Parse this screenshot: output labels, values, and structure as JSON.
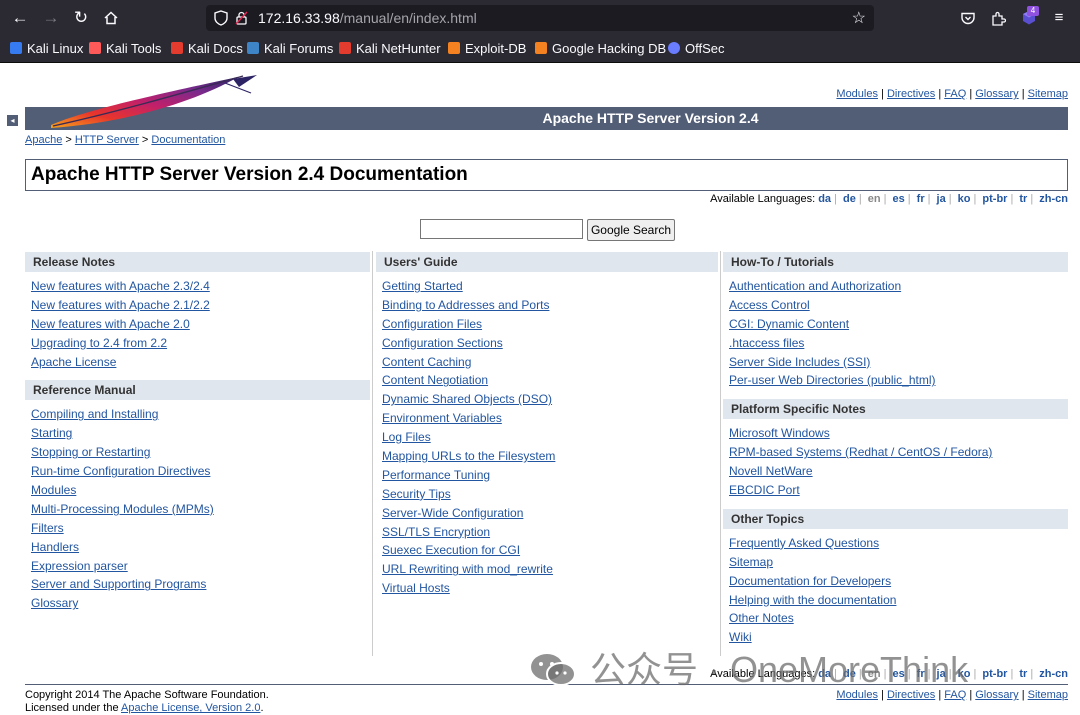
{
  "browser": {
    "url_host": "172.16.33.98",
    "url_path": "/manual/en/index.html",
    "extension_badge": "4",
    "bookmarks": [
      {
        "label": "Kali Linux",
        "color": "#367bf0"
      },
      {
        "label": "Kali Tools",
        "color": "#ff5a5a"
      },
      {
        "label": "Kali Docs",
        "color": "#e33b2e"
      },
      {
        "label": "Kali Forums",
        "color": "#3d85c6"
      },
      {
        "label": "Kali NetHunter",
        "color": "#e33b2e"
      },
      {
        "label": "Exploit-DB",
        "color": "#f58220"
      },
      {
        "label": "Google Hacking DB",
        "color": "#f58220"
      },
      {
        "label": "OffSec",
        "color": "#6a7cff"
      }
    ]
  },
  "header": {
    "top_links": [
      "Modules",
      "Directives",
      "FAQ",
      "Glossary",
      "Sitemap"
    ],
    "banner_title": "Apache HTTP Server Version 2.4",
    "breadcrumb": [
      "Apache",
      "HTTP Server",
      "Documentation"
    ],
    "toggle_glyph": "◂"
  },
  "doc_title": "Apache HTTP Server Version 2.4 Documentation",
  "languages": {
    "label": "Available Languages:",
    "items": [
      "da",
      "de",
      "en",
      "es",
      "fr",
      "ja",
      "ko",
      "pt-br",
      "tr",
      "zh-cn"
    ],
    "current": "en"
  },
  "search": {
    "value": "",
    "button_label": "Google Search"
  },
  "columns": [
    {
      "sections": [
        {
          "title": "Release Notes",
          "links": [
            "New features with Apache 2.3/2.4",
            "New features with Apache 2.1/2.2",
            "New features with Apache 2.0",
            "Upgrading to 2.4 from 2.2",
            "Apache License"
          ]
        },
        {
          "title": "Reference Manual",
          "links": [
            "Compiling and Installing",
            "Starting",
            "Stopping or Restarting",
            "Run-time Configuration Directives",
            "Modules",
            "Multi-Processing Modules (MPMs)",
            "Filters",
            "Handlers",
            "Expression parser",
            "Server and Supporting Programs",
            "Glossary"
          ]
        }
      ]
    },
    {
      "sections": [
        {
          "title": "Users' Guide",
          "links": [
            "Getting Started",
            "Binding to Addresses and Ports",
            "Configuration Files",
            "Configuration Sections",
            "Content Caching",
            "Content Negotiation",
            "Dynamic Shared Objects (DSO)",
            "Environment Variables",
            "Log Files",
            "Mapping URLs to the Filesystem",
            "Performance Tuning",
            "Security Tips",
            "Server-Wide Configuration",
            "SSL/TLS Encryption",
            "Suexec Execution for CGI",
            "URL Rewriting with mod_rewrite",
            "Virtual Hosts"
          ]
        }
      ]
    },
    {
      "sections": [
        {
          "title": "How-To / Tutorials",
          "links": [
            "Authentication and Authorization",
            "Access Control",
            "CGI: Dynamic Content",
            ".htaccess files",
            "Server Side Includes (SSI)",
            "Per-user Web Directories (public_html)"
          ]
        },
        {
          "title": "Platform Specific Notes",
          "links": [
            "Microsoft Windows",
            "RPM-based Systems (Redhat / CentOS / Fedora)",
            "Novell NetWare",
            "EBCDIC Port"
          ]
        },
        {
          "title": "Other Topics",
          "links": [
            "Frequently Asked Questions",
            "Sitemap",
            "Documentation for Developers",
            "Helping with the documentation",
            "Other Notes",
            "Wiki"
          ]
        }
      ]
    }
  ],
  "footer": {
    "copyright": "Copyright 2014 The Apache Software Foundation.",
    "license_prefix": "Licensed under the ",
    "license_link": "Apache License, Version 2.0",
    "license_suffix": ".",
    "links": [
      "Modules",
      "Directives",
      "FAQ",
      "Glossary",
      "Sitemap"
    ]
  },
  "watermark": "公众号 · OneMoreThink",
  "colors": {
    "banner": "#525d76",
    "section_head": "#e0e6ee",
    "link": "#2356a0",
    "chrome": "#2b2a33"
  }
}
